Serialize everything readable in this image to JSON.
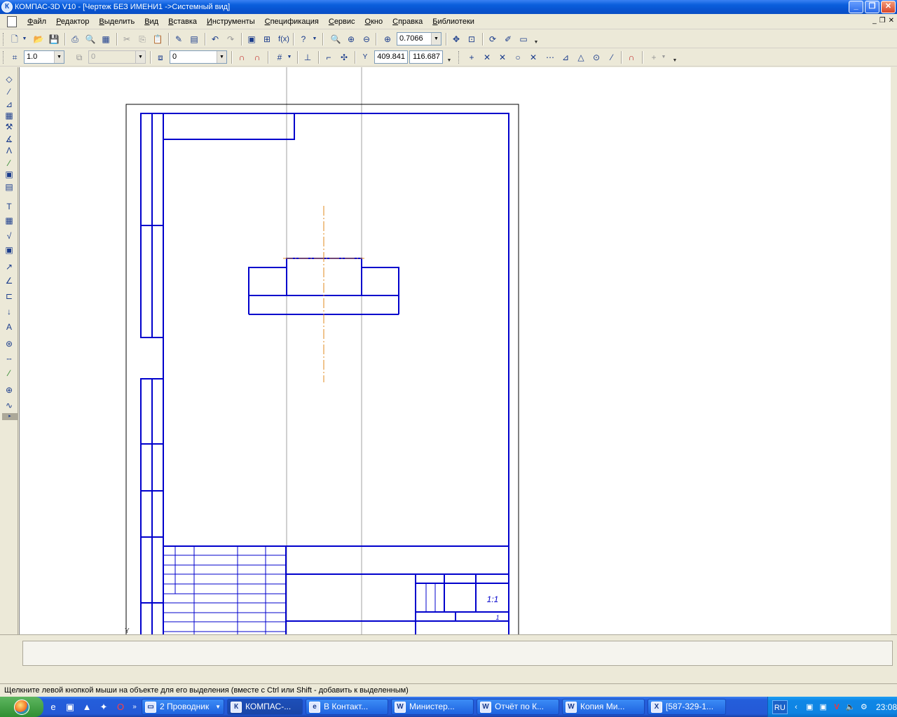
{
  "window": {
    "title": "КОМПАС-3D V10 - [Чертеж БЕЗ ИМЕНИ1 ->Системный вид]",
    "app_icon": "К",
    "buttons": [
      "minimize-icon",
      "restore-icon",
      "close-icon"
    ]
  },
  "menu": {
    "items": [
      "Файл",
      "Редактор",
      "Выделить",
      "Вид",
      "Вставка",
      "Инструменты",
      "Спецификация",
      "Сервис",
      "Окно",
      "Справка",
      "Библиотеки"
    ]
  },
  "toolbar1": {
    "zoom_value": "0.7066",
    "function_label": "f(x)"
  },
  "toolbar2": {
    "line_weight_value": "1.0",
    "style_value": "0",
    "layer_value": "0",
    "coord_x": "409.841",
    "coord_y": "116.687"
  },
  "status": {
    "message": "Щелкните левой кнопкой мыши на объекте для его выделения (вместе с Ctrl или Shift - добавить к выделенным)"
  },
  "title_block": {
    "sheets_value": "1",
    "scale_value": "1:1"
  },
  "colors": {
    "frame": "#0000cc",
    "axis": "#e08a1e",
    "guide": "#a0a0a0"
  },
  "taskbar": {
    "tasks": [
      {
        "icon": "folder-icon",
        "label": "2 Проводник"
      },
      {
        "icon": "kompas-icon",
        "label": "КОМПАС-..."
      },
      {
        "icon": "ie-icon",
        "label": "В Контакт..."
      },
      {
        "icon": "word-icon",
        "label": "Министер..."
      },
      {
        "icon": "word-icon",
        "label": "Отчёт по К..."
      },
      {
        "icon": "word-icon",
        "label": "Копия Ми..."
      },
      {
        "icon": "excel-icon",
        "label": "[587-329-1..."
      }
    ],
    "lang": "RU",
    "clock": "23:08"
  }
}
